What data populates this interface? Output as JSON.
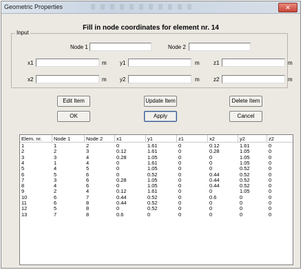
{
  "window": {
    "title": "Geometric Properties",
    "close_glyph": "✕"
  },
  "header": {
    "text": "Fill in node coordinates for element nr. 14"
  },
  "input": {
    "legend": "Input",
    "node1_label": "Node 1",
    "node2_label": "Node 2",
    "node1_value": "",
    "node2_value": "",
    "unit": "m",
    "fields": [
      {
        "label": "x1",
        "value": ""
      },
      {
        "label": "y1",
        "value": ""
      },
      {
        "label": "z1",
        "value": ""
      },
      {
        "label": "x2",
        "value": ""
      },
      {
        "label": "y2",
        "value": ""
      },
      {
        "label": "z2",
        "value": ""
      }
    ]
  },
  "buttons": {
    "edit": "Edit Item",
    "update": "Update Item",
    "delete": "Delete Item",
    "ok": "OK",
    "apply": "Apply",
    "cancel": "Cancel"
  },
  "table": {
    "columns": [
      "Elem. nr.",
      "Node 1",
      "Node 2",
      "x1",
      "y1",
      "z1",
      "x2",
      "y2",
      "z2"
    ],
    "rows": [
      [
        "1",
        "1",
        "2",
        "0",
        "1.61",
        "0",
        "0.12",
        "1.61",
        "0"
      ],
      [
        "2",
        "2",
        "3",
        "0.12",
        "1.61",
        "0",
        "0.28",
        "1.05",
        "0"
      ],
      [
        "3",
        "3",
        "4",
        "0.28",
        "1.05",
        "0",
        "0",
        "1.05",
        "0"
      ],
      [
        "4",
        "1",
        "4",
        "0",
        "1.61",
        "0",
        "0",
        "1.05",
        "0"
      ],
      [
        "5",
        "4",
        "5",
        "0",
        "1.05",
        "0",
        "0",
        "0.52",
        "0"
      ],
      [
        "6",
        "5",
        "6",
        "0",
        "0.52",
        "0",
        "0.44",
        "0.52",
        "0"
      ],
      [
        "7",
        "3",
        "6",
        "0.28",
        "1.05",
        "0",
        "0.44",
        "0.52",
        "0"
      ],
      [
        "8",
        "4",
        "6",
        "0",
        "1.05",
        "0",
        "0.44",
        "0.52",
        "0"
      ],
      [
        "9",
        "2",
        "4",
        "0.12",
        "1.61",
        "0",
        "0",
        "1.05",
        "0"
      ],
      [
        "10",
        "6",
        "7",
        "0.44",
        "0.52",
        "0",
        "0.6",
        "0",
        "0"
      ],
      [
        "11",
        "6",
        "8",
        "0.44",
        "0.52",
        "0",
        "0",
        "0",
        "0"
      ],
      [
        "12",
        "5",
        "8",
        "0",
        "0.52",
        "0",
        "0",
        "0",
        "0"
      ],
      [
        "13",
        "7",
        "8",
        "0.6",
        "0",
        "0",
        "0",
        "0",
        "0"
      ]
    ]
  }
}
